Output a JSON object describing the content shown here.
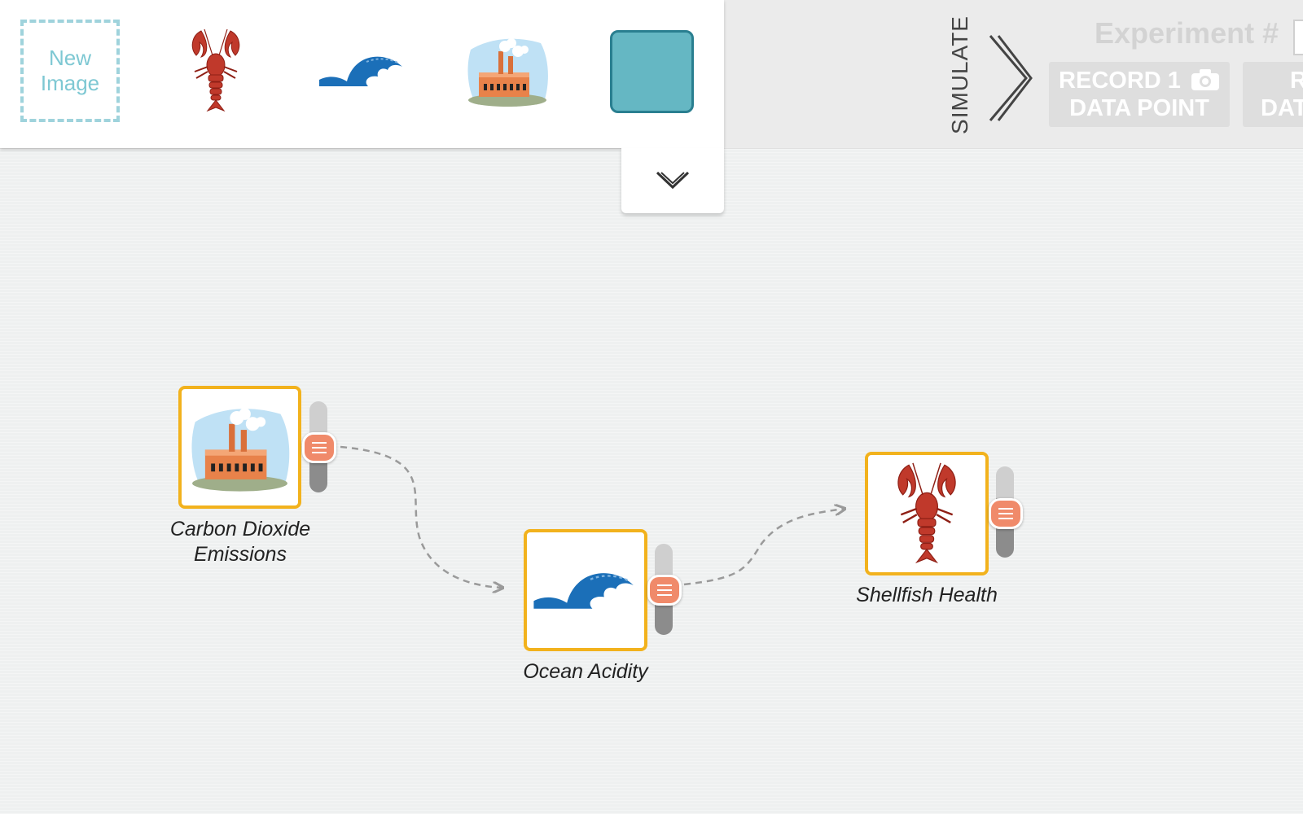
{
  "palette": {
    "new_image_label": "New Image",
    "items": [
      {
        "name": "lobster"
      },
      {
        "name": "wave"
      },
      {
        "name": "factory"
      },
      {
        "name": "blank-color",
        "color": "#65b7c3"
      }
    ],
    "expand_icon": "chevron-down"
  },
  "toolbar": {
    "simulate_label": "SIMULATE",
    "experiment_label": "Experiment #",
    "record_one": {
      "line1": "RECORD 1",
      "line2": "DATA POINT"
    },
    "record_stream": {
      "line1": "R",
      "line2": "DAT"
    }
  },
  "nodes": [
    {
      "id": "co2",
      "label_line1": "Carbon Dioxide",
      "label_line2": "Emissions",
      "image": "factory"
    },
    {
      "id": "ocean",
      "label": "Ocean Acidity",
      "image": "wave"
    },
    {
      "id": "shellfish",
      "label": "Shellfish Health",
      "image": "lobster"
    }
  ],
  "links": [
    {
      "from": "co2",
      "to": "ocean"
    },
    {
      "from": "ocean",
      "to": "shellfish"
    }
  ],
  "colors": {
    "node_border": "#f2b21d",
    "handle": "#f08a6a",
    "accent": "#65b7c3"
  }
}
